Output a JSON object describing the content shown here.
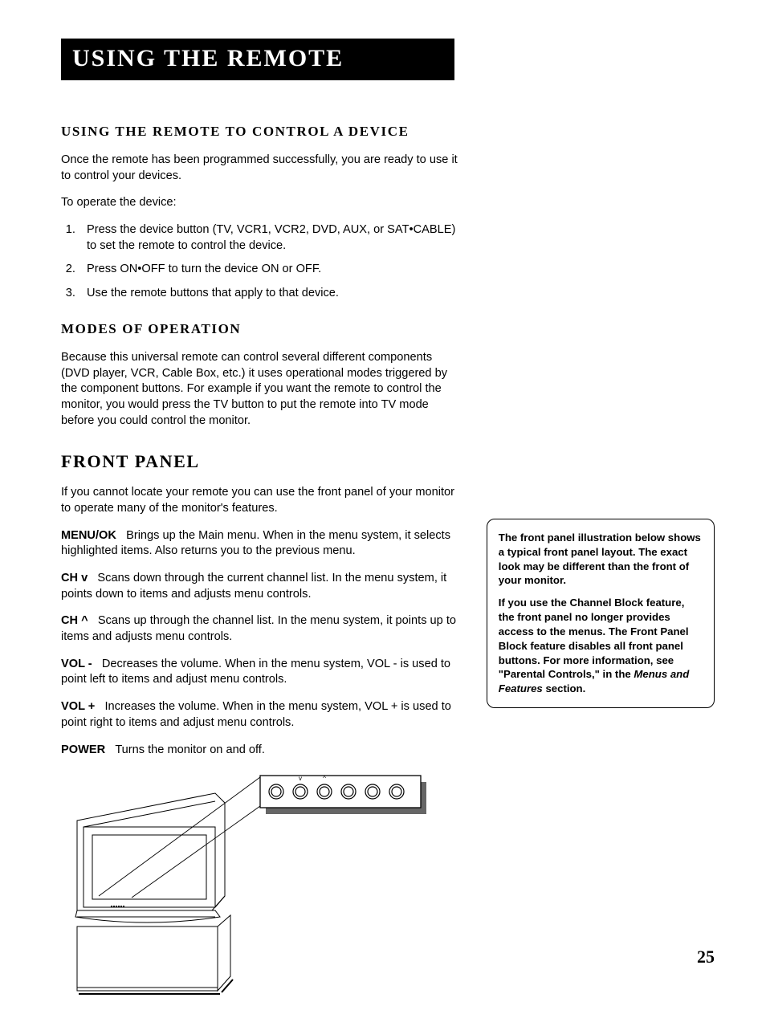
{
  "header": {
    "title": "Using the Remote"
  },
  "section1": {
    "heading": "Using the remote to control a device",
    "p1": "Once the remote has been programmed successfully, you are ready to use it to control your devices.",
    "p2": "To operate the device:",
    "steps": [
      "Press the device button (TV, VCR1, VCR2, DVD, AUX, or SAT•CABLE) to set the remote to control the device.",
      "Press ON•OFF to turn the device ON or OFF.",
      "Use the remote buttons that apply to that device."
    ]
  },
  "section2": {
    "heading": "Modes of Operation",
    "p1": "Because this universal remote can control several different components (DVD player, VCR, Cable Box, etc.) it uses operational modes triggered by the component buttons. For example if you want the remote to control the monitor, you would press the TV button to put the remote into TV mode before you could control the monitor."
  },
  "section3": {
    "heading": "Front Panel",
    "p1": "If you cannot locate your remote you can use the front panel of your monitor to operate many of the monitor's features.",
    "defs": [
      {
        "term": "MENU/OK",
        "desc": "Brings up the Main menu. When in the menu system, it selects highlighted items. Also returns you to the previous menu."
      },
      {
        "term": "CH v",
        "desc": "Scans down through the current channel list. In the menu system, it points down to items and adjusts menu controls."
      },
      {
        "term": "CH ^",
        "desc": "Scans up through the channel list. In the menu system, it points up to items and adjusts menu controls."
      },
      {
        "term": "VOL -",
        "desc": "Decreases the volume. When in the menu system, VOL - is used to point left to items and adjust menu controls."
      },
      {
        "term": "VOL +",
        "desc": "Increases the volume. When in the menu system, VOL + is used to point right to items and adjust menu controls."
      },
      {
        "term": "POWER",
        "desc": "Turns the monitor on and off."
      }
    ]
  },
  "sidenote": {
    "p1": "The front panel illustration below shows a typical front panel layout. The exact look may be different than the front of your monitor.",
    "p2_a": "If you use the Channel Block feature, the front panel no longer provides access to the menus. The Front Panel Block feature disables all front panel buttons. For more information, see \"Parental Controls,\" in the ",
    "p2_it": "Menus and Features",
    "p2_b": " section."
  },
  "page_number": "25",
  "illustration": {
    "button_labels": {
      "ch_down": "v",
      "ch_up": "^"
    }
  }
}
